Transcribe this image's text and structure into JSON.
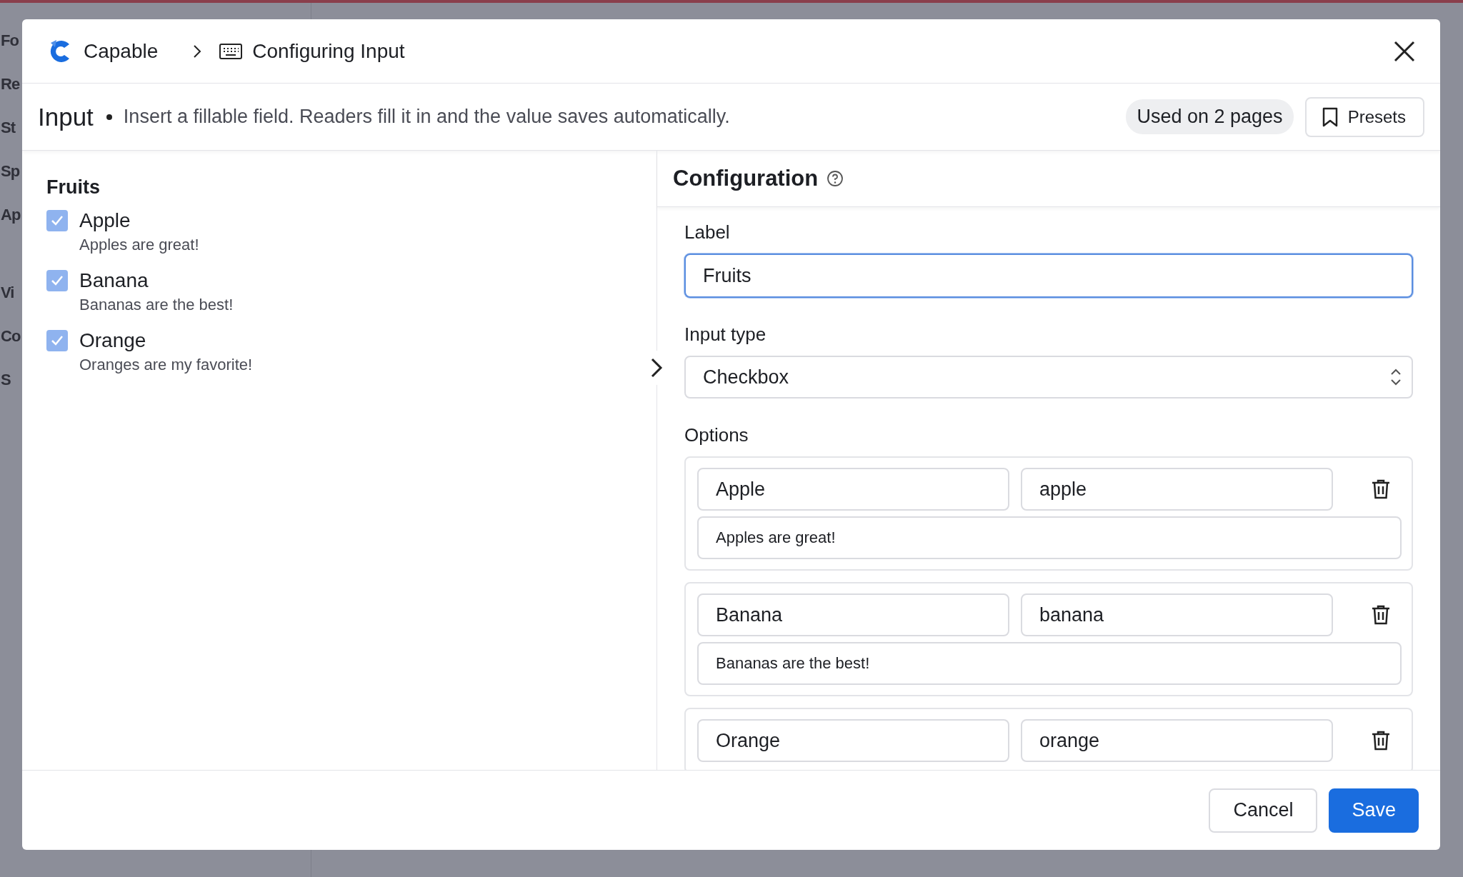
{
  "background": {
    "sidebar_items": [
      "Fo",
      "Re",
      "St",
      "Sp",
      "Ap",
      "Vi",
      "Co",
      "S"
    ]
  },
  "header": {
    "app_name": "Capable",
    "breadcrumb": "Configuring Input"
  },
  "subheader": {
    "title": "Input",
    "description": "Insert a fillable field. Readers fill it in and the value saves automatically.",
    "usage_badge": "Used on 2 pages",
    "presets_button": "Presets"
  },
  "preview": {
    "label": "Fruits",
    "options": [
      {
        "label": "Apple",
        "description": "Apples are great!",
        "checked": true
      },
      {
        "label": "Banana",
        "description": "Bananas are the best!",
        "checked": true
      },
      {
        "label": "Orange",
        "description": "Oranges are my favorite!",
        "checked": true
      }
    ]
  },
  "configuration": {
    "title": "Configuration",
    "label_field": {
      "label": "Label",
      "value": "Fruits"
    },
    "input_type": {
      "label": "Input type",
      "value": "Checkbox"
    },
    "options_label": "Options",
    "options": [
      {
        "name": "Apple",
        "value": "apple",
        "description": "Apples are great!"
      },
      {
        "name": "Banana",
        "value": "banana",
        "description": "Bananas are the best!"
      },
      {
        "name": "Orange",
        "value": "orange"
      }
    ]
  },
  "footer": {
    "buttons": [
      {
        "label": "Cancel",
        "kind": "secondary"
      },
      {
        "label": "Save",
        "kind": "primary"
      }
    ]
  }
}
